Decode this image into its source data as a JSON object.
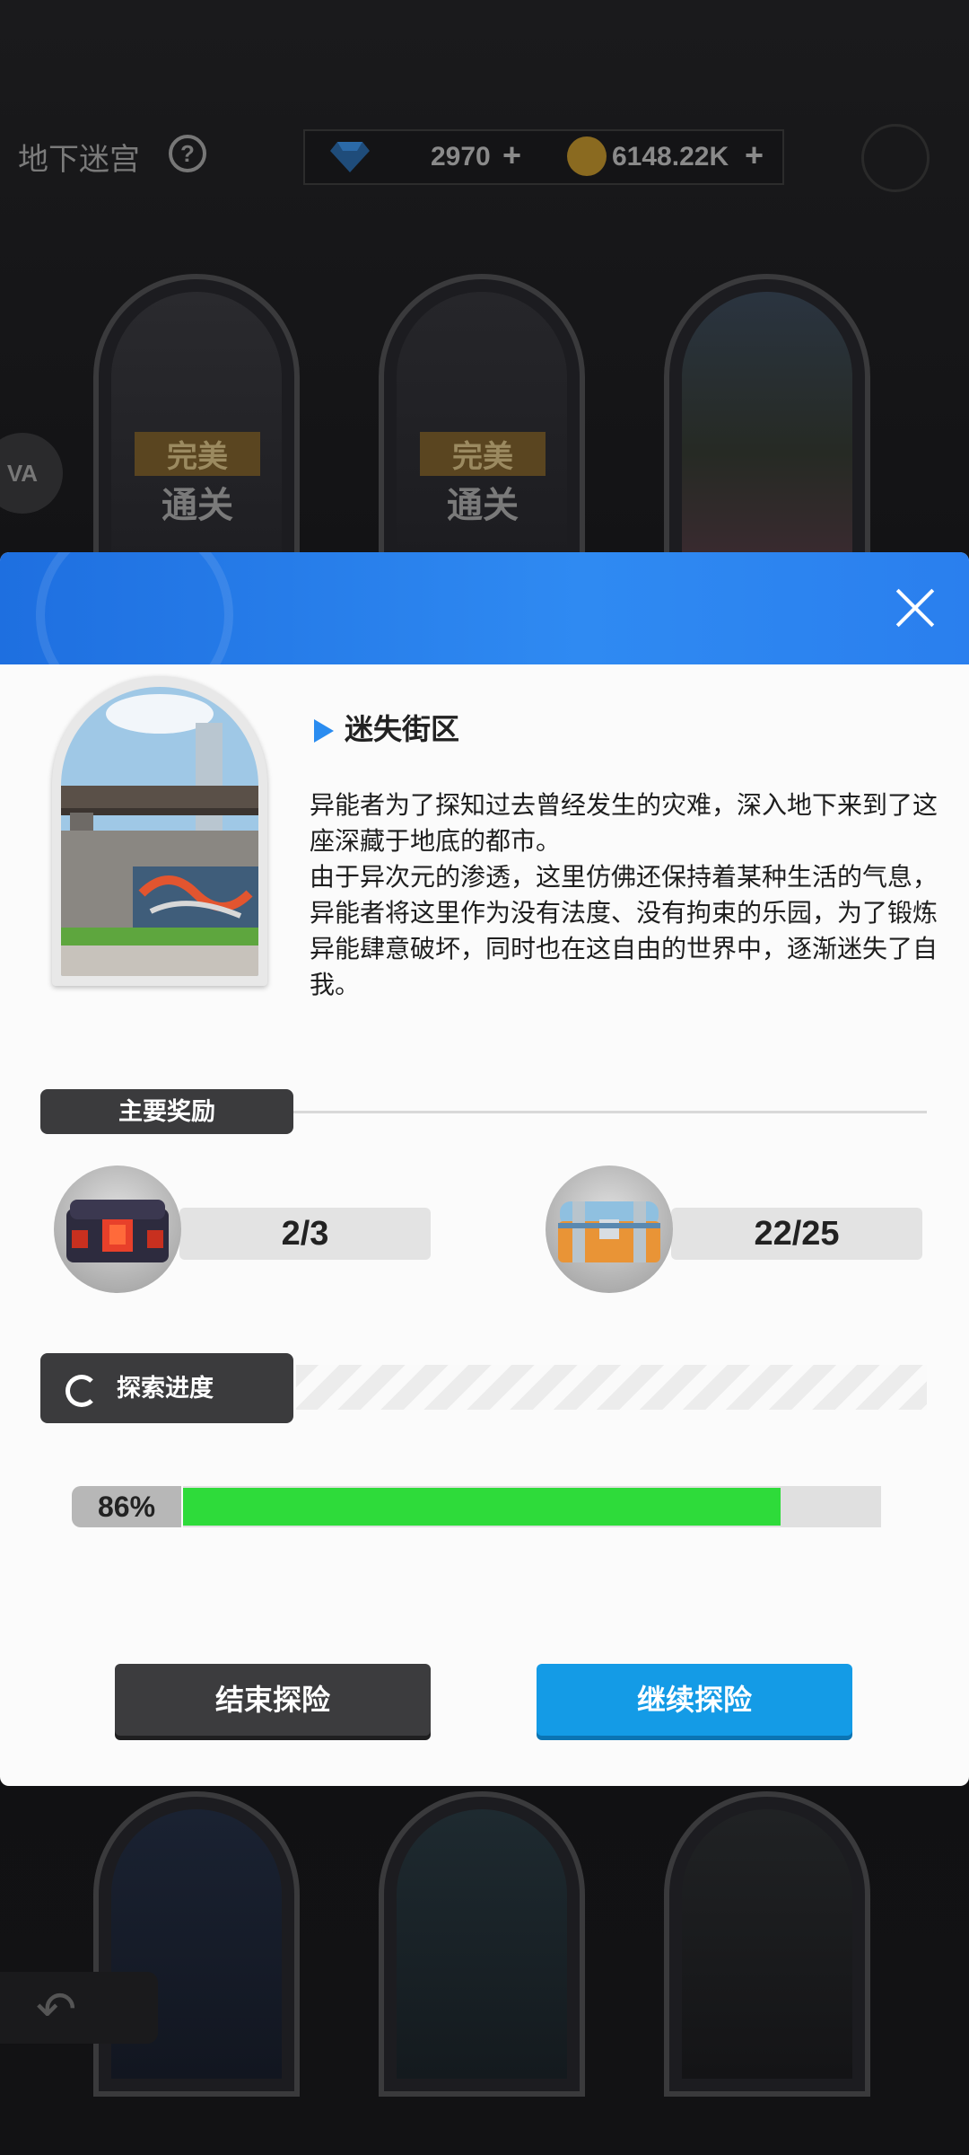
{
  "top_bar": {
    "title": "地下迷宫",
    "help_icon": "question-circle-icon",
    "gems": "2970",
    "coins": "6148.22K",
    "plus": "+"
  },
  "arch_badges": [
    {
      "top": "完美",
      "bottom": "通关"
    },
    {
      "top": "完美",
      "bottom": "通关"
    }
  ],
  "side_logo": "VA",
  "modal": {
    "location_title": "迷失街区",
    "description": [
      "异能者为了探知过去曾经发生的灾难，深入地下来到了这座深藏于地底的都市。",
      "由于异次元的渗透，这里仿佛还保持着某种生活的气息，异能者将这里作为没有法度、没有拘束的乐园，为了锻炼异能肆意破坏，同时也在这自由的世界中，逐渐迷失了自我。"
    ],
    "rewards_label": "主要奖励",
    "rewards": [
      {
        "icon": "dark-red-chest-icon",
        "count": "2/3"
      },
      {
        "icon": "blue-gold-chest-icon",
        "count": "22/25"
      }
    ],
    "progress_label": "探索进度",
    "progress_text": "86%",
    "progress_value": 0.86,
    "end_button": "结束探险",
    "continue_button": "继续探险",
    "colors": {
      "header_blue": "#2a7fee",
      "progress_green": "#2edb3a",
      "continue_blue": "#149be6",
      "dark_button": "#3c3c3e"
    }
  }
}
